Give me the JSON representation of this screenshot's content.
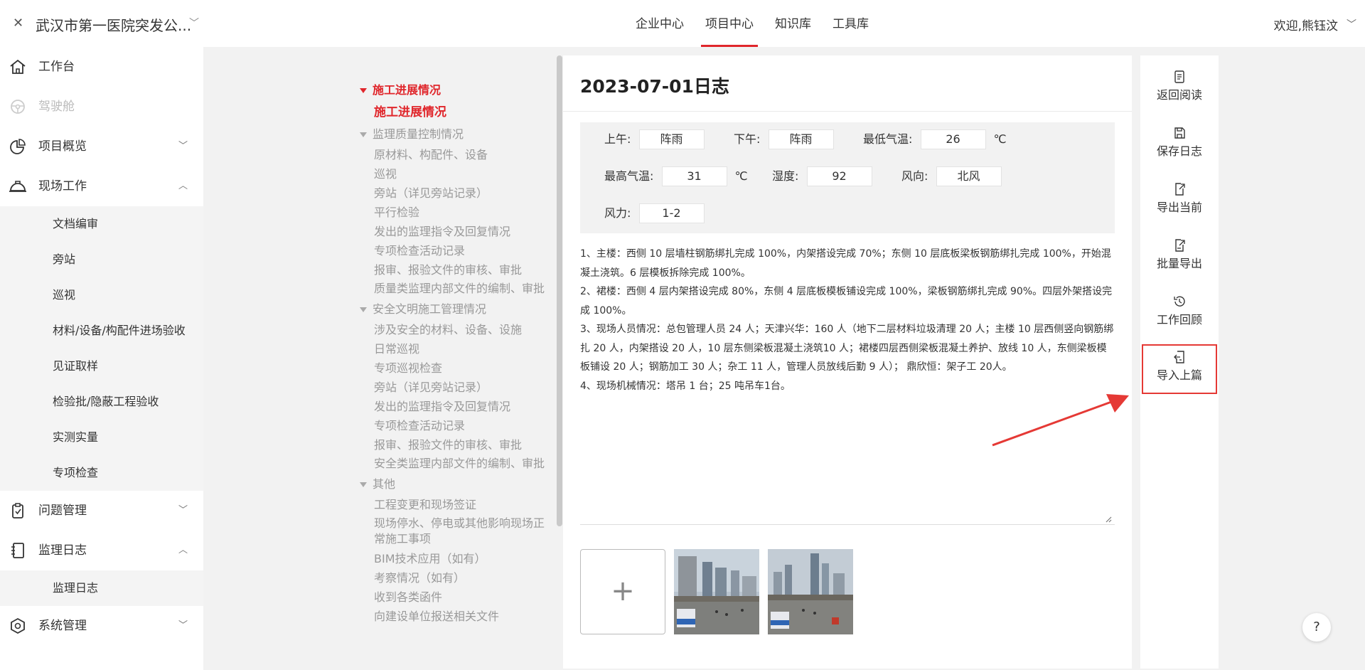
{
  "header": {
    "project_title": "武汉市第一医院突发公...",
    "nav": [
      "企业中心",
      "项目中心",
      "知识库",
      "工具库"
    ],
    "welcome": "欢迎,熊钰汶"
  },
  "sidebar": {
    "items": [
      {
        "label": "工作台"
      },
      {
        "label": "驾驶舱"
      },
      {
        "label": "项目概览"
      },
      {
        "label": "现场工作"
      },
      {
        "label": "问题管理"
      },
      {
        "label": "监理日志"
      },
      {
        "label": "系统管理"
      }
    ],
    "field_work_sub": [
      "文档编审",
      "旁站",
      "巡视",
      "材料/设备/构配件进场验收",
      "见证取样",
      "检验批/隐蔽工程验收",
      "实测实量",
      "专项检查"
    ],
    "log_sub": [
      "监理日志"
    ]
  },
  "toc": {
    "sections": [
      {
        "title": "施工进展情况",
        "items": [
          "施工进展情况"
        ]
      },
      {
        "title": "监理质量控制情况",
        "items": [
          "原材料、构配件、设备",
          "巡视",
          "旁站（详见旁站记录）",
          "平行检验",
          "发出的监理指令及回复情况",
          "专项检查活动记录",
          "报审、报验文件的审核、审批",
          "质量类监理内部文件的编制、审批"
        ]
      },
      {
        "title": "安全文明施工管理情况",
        "items": [
          "涉及安全的材料、设备、设施",
          "日常巡视",
          "专项巡视检查",
          "旁站（详见旁站记录）",
          "发出的监理指令及回复情况",
          "专项检查活动记录",
          "报审、报验文件的审核、审批",
          "安全类监理内部文件的编制、审批"
        ]
      },
      {
        "title": "其他",
        "items": [
          "工程变更和现场签证",
          "现场停水、停电或其他影响现场正常施工事项",
          "BIM技术应用（如有）",
          "考察情况（如有）",
          "收到各类函件",
          "向建设单位报送相关文件"
        ]
      }
    ]
  },
  "log": {
    "title": "2023-07-01日志",
    "weather": {
      "am_label": "上午:",
      "am": "阵雨",
      "pm_label": "下午:",
      "pm": "阵雨",
      "min_label": "最低气温:",
      "min": "26",
      "min_unit": "℃",
      "max_label": "最高气温:",
      "max": "31",
      "max_unit": "℃",
      "humidity_label": "湿度:",
      "humidity": "92",
      "wind_dir_label": "风向:",
      "wind_dir": "北风",
      "wind_force_label": "风力:",
      "wind_force": "1-2"
    },
    "content": [
      "1、主楼：西侧 10 层墙柱钢筋绑扎完成 100%，内架搭设完成 70%；东侧 10 层底板梁板钢筋绑扎完成 100%，开始混凝土浇筑。6 层模板拆除完成 100%。",
      "2、裙楼：西侧 4 层内架搭设完成 80%，东侧 4 层底板模板铺设完成 100%，梁板钢筋绑扎完成 90%。四层外架搭设完成 100%。",
      "3、现场人员情况：总包管理人员 24 人；天津兴华：160 人（地下二层材料垃圾清理 20 人；主楼 10 层西侧竖向钢筋绑扎 20 人，内架搭设 20 人，10 层东侧梁板混凝土浇筑10 人；裙楼四层西侧梁板混凝土养护、放线 10 人，东侧梁板模板铺设 20 人；钢筋加工 30 人；杂工 11 人，管理人员放线后勤 9 人）； 鼎欣恒：架子工 20人。",
      "4、现场机械情况：塔吊 1 台；25 吨吊车1台。"
    ],
    "upload_symbol": "+"
  },
  "actions": [
    "返回阅读",
    "保存日志",
    "导出当前",
    "批量导出",
    "工作回顾",
    "导入上篇"
  ],
  "help": "?"
}
